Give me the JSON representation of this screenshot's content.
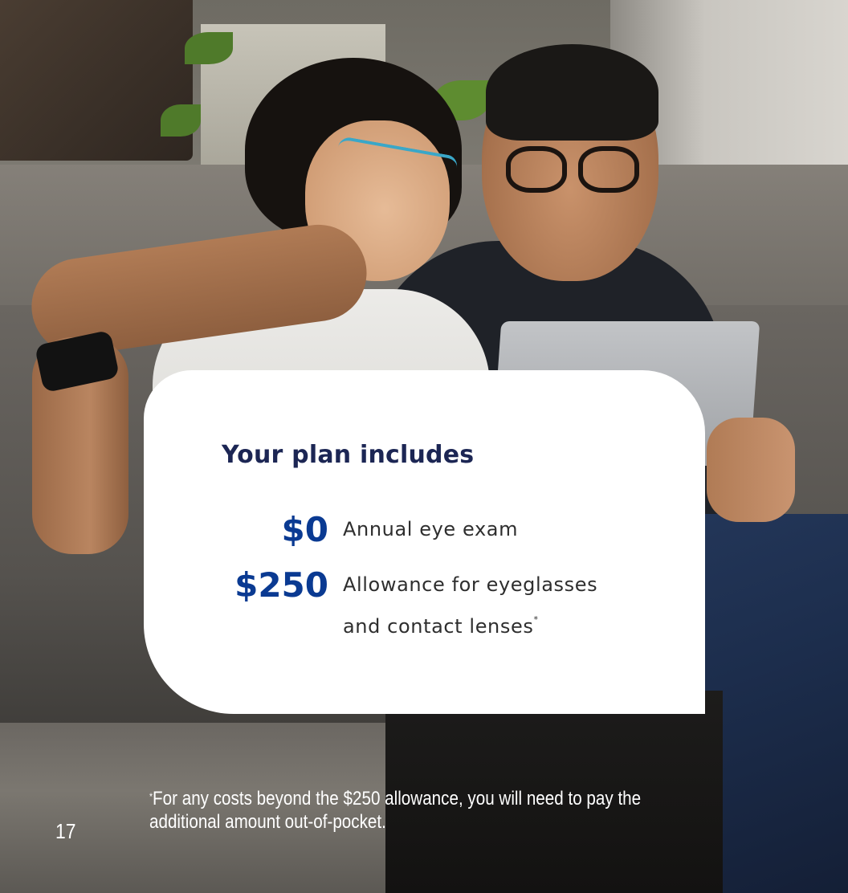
{
  "card": {
    "title": "Your plan includes",
    "benefits": [
      {
        "amount": "$0",
        "description_lines": [
          "Annual eye exam"
        ]
      },
      {
        "amount": "$250",
        "description_lines": [
          "Allowance for eyeglasses",
          "and contact lenses"
        ],
        "footnote_marker": "*"
      }
    ]
  },
  "footnote": {
    "marker": "*",
    "text": "For any costs beyond the $250 allowance, you will need to pay the additional amount out-of-pocket."
  },
  "page_number": "17",
  "colors": {
    "title": "#1c2654",
    "amount": "#0a3a92",
    "card_background": "#ffffff",
    "footnote_text": "#ffffff"
  },
  "background_photo_description_icon": "photo-couple-on-sofa-with-tablet"
}
